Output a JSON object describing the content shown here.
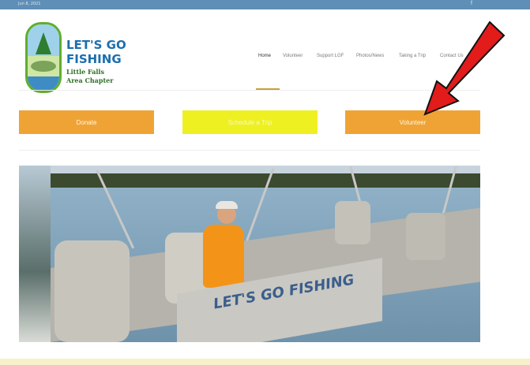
{
  "topbar": {
    "date": "Jun 8, 2021",
    "facebook_icon": "facebook-icon"
  },
  "logo": {
    "line1": "LET'S GO",
    "line2": "FISHING",
    "line3": "Little Falls",
    "line4": "Area Chapter"
  },
  "nav": {
    "items": [
      "Home",
      "Volunteer",
      "Support LGF",
      "Photos/News",
      "Taking a Trip",
      "Contact Us"
    ],
    "active": "Home"
  },
  "buttons": {
    "donate": "Donate",
    "schedule": "Schedule a Trip",
    "volunteer": "Volunteer"
  },
  "hero": {
    "boat_text": "LET'S GO FISHING",
    "alt": "Pontoon boat with captain"
  },
  "colors": {
    "topbar": "#5f8fb6",
    "orange": "#f0a335",
    "yellow": "#eef022",
    "logo_blue": "#1b6fae",
    "logo_green": "#2e6f26",
    "arrow_red": "#e21b1b"
  }
}
